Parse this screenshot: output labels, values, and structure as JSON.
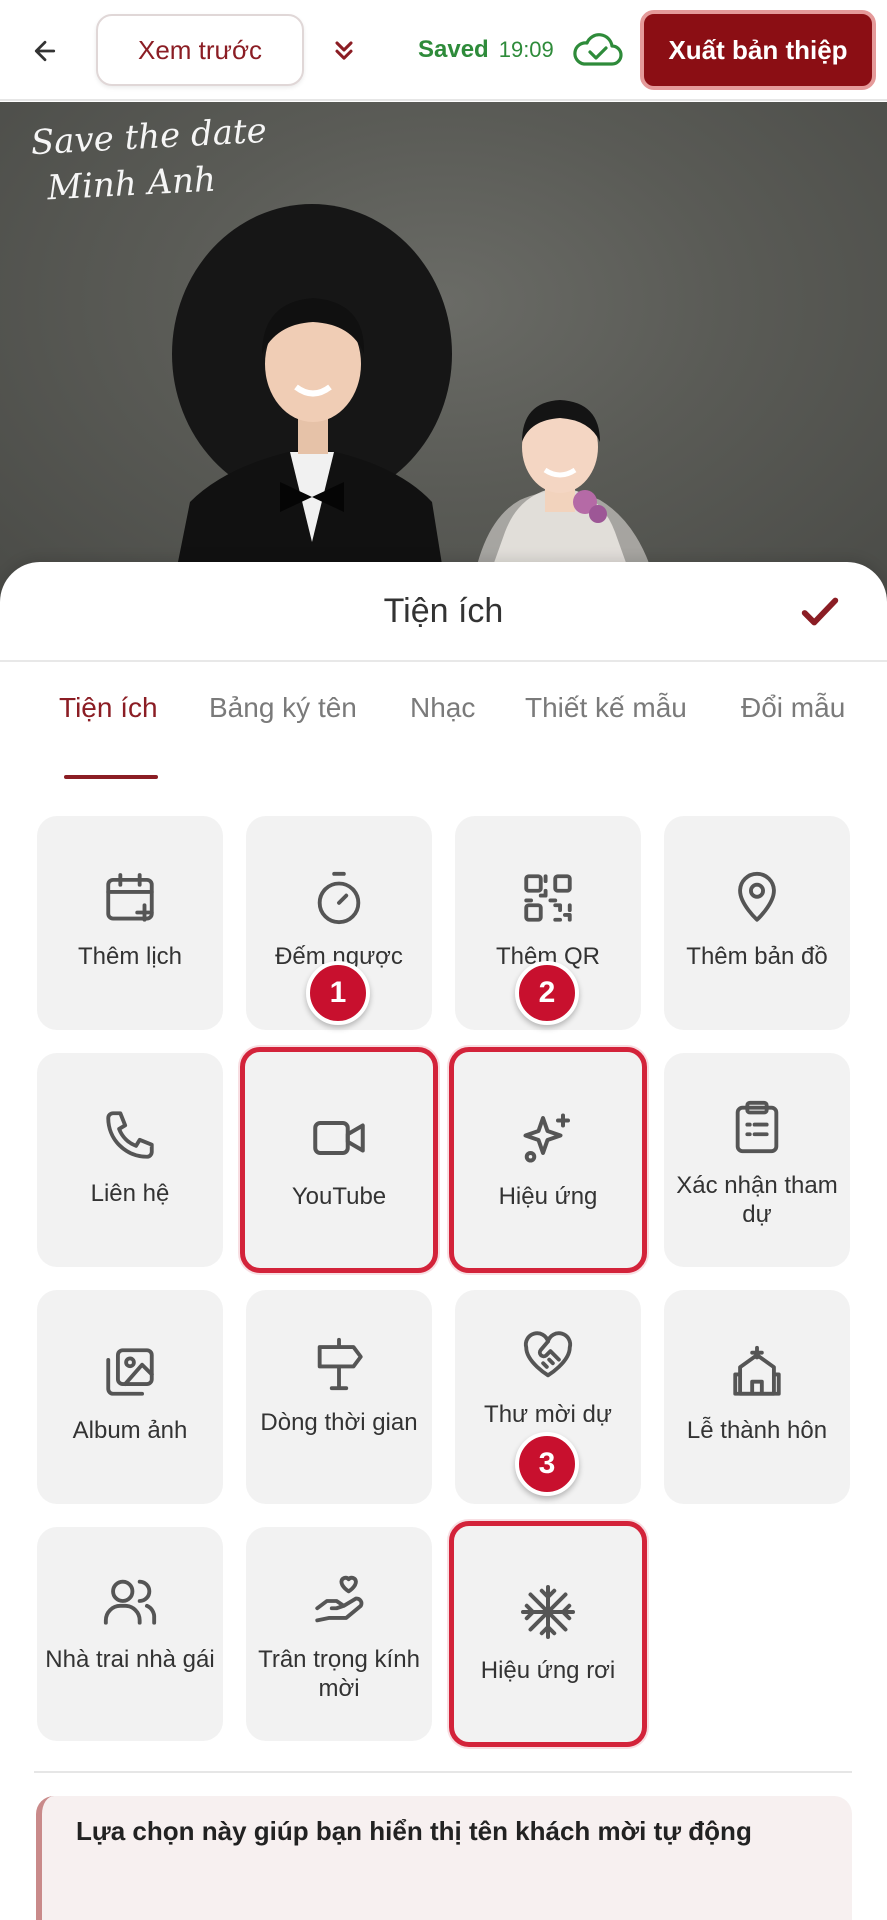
{
  "topbar": {
    "preview_label": "Xem trước",
    "saved_label": "Saved",
    "saved_time": "19:09",
    "export_label": "Xuất bản thiệp"
  },
  "photo": {
    "script_line1": "Save the date",
    "script_line2": "Minh Anh"
  },
  "sheet": {
    "title": "Tiện ích",
    "tabs": [
      {
        "label": "Tiện ích",
        "active": true
      },
      {
        "label": "Bảng ký tên",
        "active": false
      },
      {
        "label": "Nhạc",
        "active": false
      },
      {
        "label": "Thiết kế mẫu",
        "active": false
      },
      {
        "label": "Đổi mẫu",
        "active": false
      }
    ],
    "tiles": [
      {
        "label": "Thêm lịch",
        "icon": "calendar-plus-icon"
      },
      {
        "label": "Đếm ngược",
        "icon": "timer-icon"
      },
      {
        "label": "Thêm QR",
        "icon": "qr-code-icon"
      },
      {
        "label": "Thêm bản đồ",
        "icon": "map-pin-icon"
      },
      {
        "label": "Liên hệ",
        "icon": "phone-icon"
      },
      {
        "label": "YouTube",
        "icon": "video-camera-icon",
        "highlighted": true
      },
      {
        "label": "Hiệu ứng",
        "icon": "sparkles-icon",
        "highlighted": true
      },
      {
        "label": "Xác nhận tham dự",
        "icon": "clipboard-list-icon"
      },
      {
        "label": "Album ảnh",
        "icon": "images-icon"
      },
      {
        "label": "Dòng thời gian",
        "icon": "signpost-icon"
      },
      {
        "label": "Thư mời dự",
        "icon": "heart-handshake-icon"
      },
      {
        "label": "Lễ thành hôn",
        "icon": "church-icon"
      },
      {
        "label": "Nhà trai nhà gái",
        "icon": "users-icon"
      },
      {
        "label": "Trân trọng kính mời",
        "icon": "hand-heart-icon"
      },
      {
        "label": "Hiệu ứng rơi",
        "icon": "snowflake-icon",
        "highlighted": true
      }
    ],
    "markers": [
      "1",
      "2",
      "3"
    ],
    "note": "Lựa chọn này giúp bạn hiển thị tên khách mời tự động"
  },
  "colors": {
    "brand": "#8b0e14",
    "highlight": "#d3233a",
    "saved": "#2e8b3a"
  }
}
